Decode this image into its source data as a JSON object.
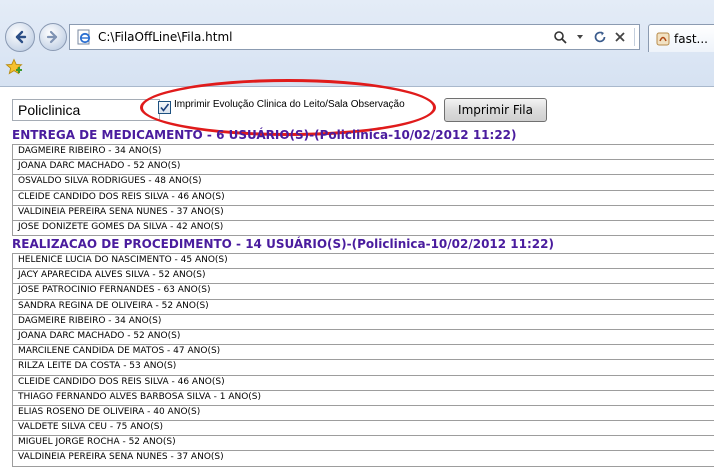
{
  "browser": {
    "address": "C:\\FilaOffLine\\Fila.html",
    "tab_label": "fast..."
  },
  "page": {
    "unit_select": {
      "value": "Policlinica"
    },
    "print_checkbox": {
      "label": "Imprimir Evolução Clinica do Leito/Sala Observação",
      "checked": true
    },
    "print_button_label": "Imprimir Fila",
    "groups": [
      {
        "title": "ENTREGA DE MEDICAMENTO - 6 USUÁRIO(S)-(Policlinica-10/02/2012 11:22)",
        "rows": [
          "DAGMEIRE RIBEIRO - 34 ANO(S)",
          "JOANA DARC MACHADO - 52 ANO(S)",
          "OSVALDO SILVA RODRIGUES - 48 ANO(S)",
          "CLEIDE CANDIDO DOS REIS SILVA - 46 ANO(S)",
          "VALDINEIA PEREIRA SENA NUNES - 37 ANO(S)",
          "JOSE DONIZETE GOMES DA SILVA - 42 ANO(S)"
        ]
      },
      {
        "title": "REALIZACAO DE PROCEDIMENTO - 14 USUÁRIO(S)-(Policlinica-10/02/2012 11:22)",
        "rows": [
          "HELENICE LUCIA DO NASCIMENTO - 45 ANO(S)",
          "JACY APARECIDA ALVES SILVA - 52 ANO(S)",
          "JOSE PATROCINIO FERNANDES - 63 ANO(S)",
          "SANDRA REGINA DE OLIVEIRA - 52 ANO(S)",
          "DAGMEIRE RIBEIRO - 34 ANO(S)",
          "JOANA DARC MACHADO - 52 ANO(S)",
          "MARCILENE CANDIDA DE MATOS - 47 ANO(S)",
          "RILZA LEITE DA COSTA - 53 ANO(S)",
          "CLEIDE CANDIDO DOS REIS SILVA - 46 ANO(S)",
          "THIAGO FERNANDO ALVES BARBOSA SILVA - 1 ANO(S)",
          "ELIAS ROSENO DE OLIVEIRA - 40 ANO(S)",
          "VALDETE SILVA CEU - 75 ANO(S)",
          "MIGUEL JORGE ROCHA - 52 ANO(S)",
          "VALDINEIA PEREIRA SENA NUNES - 37 ANO(S)"
        ]
      }
    ]
  },
  "colors": {
    "group_title": "#4a1c9e",
    "highlight_ellipse": "#e01b1b"
  },
  "icons": [
    "back-arrow-icon",
    "forward-arrow-icon",
    "ie-page-icon",
    "search-icon",
    "dropdown-arrow-icon",
    "refresh-icon",
    "stop-icon",
    "tab-favicon-icon",
    "favorites-star-icon",
    "checkmark-icon"
  ]
}
